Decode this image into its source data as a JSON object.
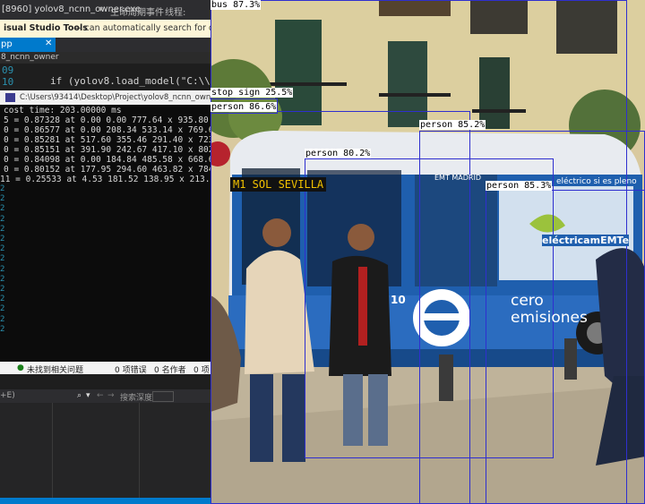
{
  "titlebar": {
    "title": "[8960] yolov8_ncnn_owner.exe",
    "lifecycle": "生命周期事件",
    "thread": "线程:"
  },
  "notification": {
    "product": "isual Studio Tools",
    "message": "— can automatically search for development r"
  },
  "editor": {
    "tab_label": "pp",
    "tab_close": "✕",
    "breadcrumb": "8_ncnn_owner",
    "line_numbers": [
      "09",
      "10"
    ],
    "code_line": "if (yolov8.load_model(\"C:\\\\Use"
  },
  "console": {
    "title": "C:\\Users\\93414\\Desktop\\Project\\yolov8_ncnn_owner\\x64\\Rel",
    "gutter": [
      "5",
      "0",
      "0",
      "0",
      "0",
      "0",
      "11",
      "2",
      "2",
      "2",
      "2",
      "2",
      "2",
      "2",
      "2",
      "2",
      "2",
      "2",
      "2",
      "2",
      "2",
      "2"
    ],
    "lines": [
      "cost time:  203.00000 ms",
      "5 = 0.87328 at 0.00 0.00 777.64 x 935.80",
      "0 = 0.86577 at 0.00 208.34 533.14 x 769.66",
      "0 = 0.85281 at 517.60 355.46 291.40 x 723.54",
      "0 = 0.85151 at 391.90 242.67 417.10 x 802.88",
      "0 = 0.84098 at 0.00 184.84 485.58 x 668.64",
      "0 = 0.80152 at 177.95 294.60 463.82 x 784.40",
      "11 = 0.25533 at 4.53 181.52 138.95 x 213.52"
    ]
  },
  "statusbar": {
    "no_issues": "未找到相关问题",
    "errors": "0 项错误",
    "warnings": "0 名作者",
    "messages": "0 项"
  },
  "findbar": {
    "shortcut": "+E)",
    "search_placeholder": "搜索深度"
  },
  "detections": [
    {
      "label": "bus 87.3%"
    },
    {
      "label": "stop sign 25.5%"
    },
    {
      "label": "person 86.6%"
    },
    {
      "label": "person 85.2%"
    },
    {
      "label": "person 80.2%"
    },
    {
      "label": "person 85.3%"
    }
  ],
  "photo_scene": {
    "bus_destination": "M1 SOL SEVILLA",
    "ad_text": "eléctricamEMTe",
    "side_slogan_1": "cero",
    "side_slogan_2": "emisiones",
    "route_number": "10",
    "brand": "EMT MADRID",
    "banner": "eléctrico si es pleno"
  },
  "colors": {
    "box": "#2f2fcf",
    "bus": "#1f5fae",
    "accent": "#007acc"
  }
}
